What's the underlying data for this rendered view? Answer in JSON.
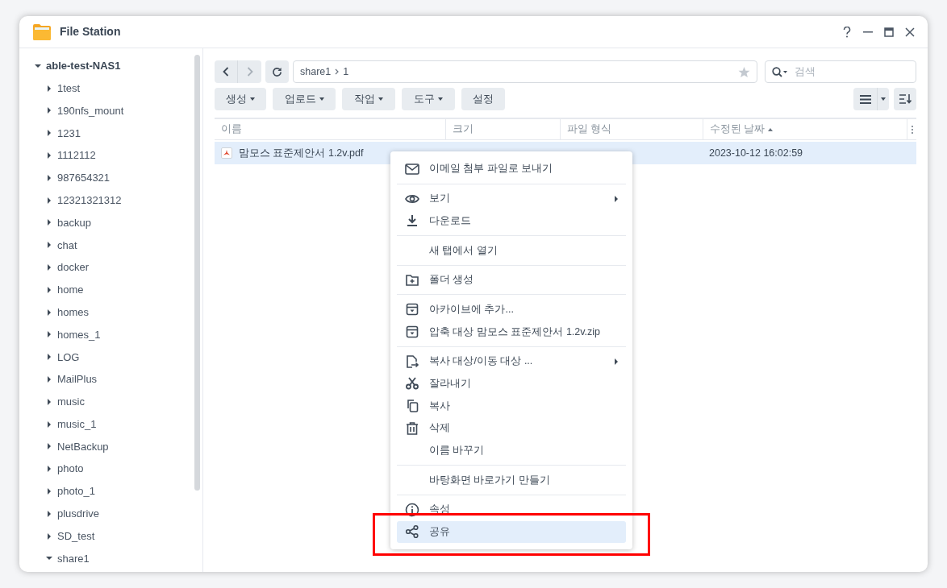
{
  "window": {
    "title": "File Station"
  },
  "sidebar": {
    "tree": [
      {
        "label": "able-test-NAS1",
        "expanded": true,
        "children": [
          {
            "label": "1test",
            "expanded": false
          },
          {
            "label": "190nfs_mount",
            "expanded": false
          },
          {
            "label": "1231",
            "expanded": false
          },
          {
            "label": "1112112",
            "expanded": false
          },
          {
            "label": "987654321",
            "expanded": false
          },
          {
            "label": "12321321312",
            "expanded": false
          },
          {
            "label": "backup",
            "expanded": false
          },
          {
            "label": "chat",
            "expanded": false
          },
          {
            "label": "docker",
            "expanded": false
          },
          {
            "label": "home",
            "expanded": false
          },
          {
            "label": "homes",
            "expanded": false
          },
          {
            "label": "homes_1",
            "expanded": false
          },
          {
            "label": "LOG",
            "expanded": false
          },
          {
            "label": "MailPlus",
            "expanded": false
          },
          {
            "label": "music",
            "expanded": false
          },
          {
            "label": "music_1",
            "expanded": false
          },
          {
            "label": "NetBackup",
            "expanded": false
          },
          {
            "label": "photo",
            "expanded": false
          },
          {
            "label": "photo_1",
            "expanded": false
          },
          {
            "label": "plusdrive",
            "expanded": false
          },
          {
            "label": "SD_test",
            "expanded": false
          },
          {
            "label": "share1",
            "expanded": true
          }
        ]
      }
    ]
  },
  "path": {
    "segments": [
      "share1",
      "1"
    ],
    "favorite": false
  },
  "search": {
    "placeholder": "검색"
  },
  "actions": [
    {
      "label": "생성",
      "has_menu": true
    },
    {
      "label": "업로드",
      "has_menu": true
    },
    {
      "label": "작업",
      "has_menu": true
    },
    {
      "label": "도구",
      "has_menu": true
    },
    {
      "label": "설정",
      "has_menu": false
    }
  ],
  "table": {
    "columns": [
      {
        "label": "이름",
        "sorted": false
      },
      {
        "label": "크기",
        "sorted": false
      },
      {
        "label": "파일 형식",
        "sorted": false
      },
      {
        "label": "수정된 날짜",
        "sorted": true
      }
    ],
    "rows": [
      {
        "name": "맘모스 표준제안서 1.2v.pdf",
        "modified": "2023-10-12 16:02:59",
        "selected": true
      }
    ]
  },
  "context_menu": [
    {
      "label": "이메일 첨부 파일로 보내기",
      "submenu": false,
      "separator_before": false,
      "highlighted": false
    },
    {
      "label": "보기",
      "submenu": true,
      "separator_before": true,
      "highlighted": false
    },
    {
      "label": "다운로드",
      "submenu": false,
      "separator_before": false,
      "highlighted": false
    },
    {
      "label": "새 탭에서 열기",
      "submenu": false,
      "separator_before": true,
      "highlighted": false
    },
    {
      "label": "폴더 생성",
      "submenu": false,
      "separator_before": true,
      "highlighted": false
    },
    {
      "label": "아카이브에 추가...",
      "submenu": false,
      "separator_before": true,
      "highlighted": false
    },
    {
      "label": "압축 대상 맘모스 표준제안서 1.2v.zip",
      "submenu": false,
      "separator_before": false,
      "highlighted": false
    },
    {
      "label": "복사 대상/이동 대상 ...",
      "submenu": true,
      "separator_before": true,
      "highlighted": false
    },
    {
      "label": "잘라내기",
      "submenu": false,
      "separator_before": false,
      "highlighted": false
    },
    {
      "label": "복사",
      "submenu": false,
      "separator_before": false,
      "highlighted": false
    },
    {
      "label": "삭제",
      "submenu": false,
      "separator_before": false,
      "highlighted": false
    },
    {
      "label": "이름 바꾸기",
      "submenu": false,
      "separator_before": false,
      "highlighted": false
    },
    {
      "label": "바탕화면 바로가기 만들기",
      "submenu": false,
      "separator_before": true,
      "highlighted": false
    },
    {
      "label": "속성",
      "submenu": false,
      "separator_before": true,
      "highlighted": false
    },
    {
      "label": "공유",
      "submenu": false,
      "separator_before": false,
      "highlighted": true
    }
  ]
}
